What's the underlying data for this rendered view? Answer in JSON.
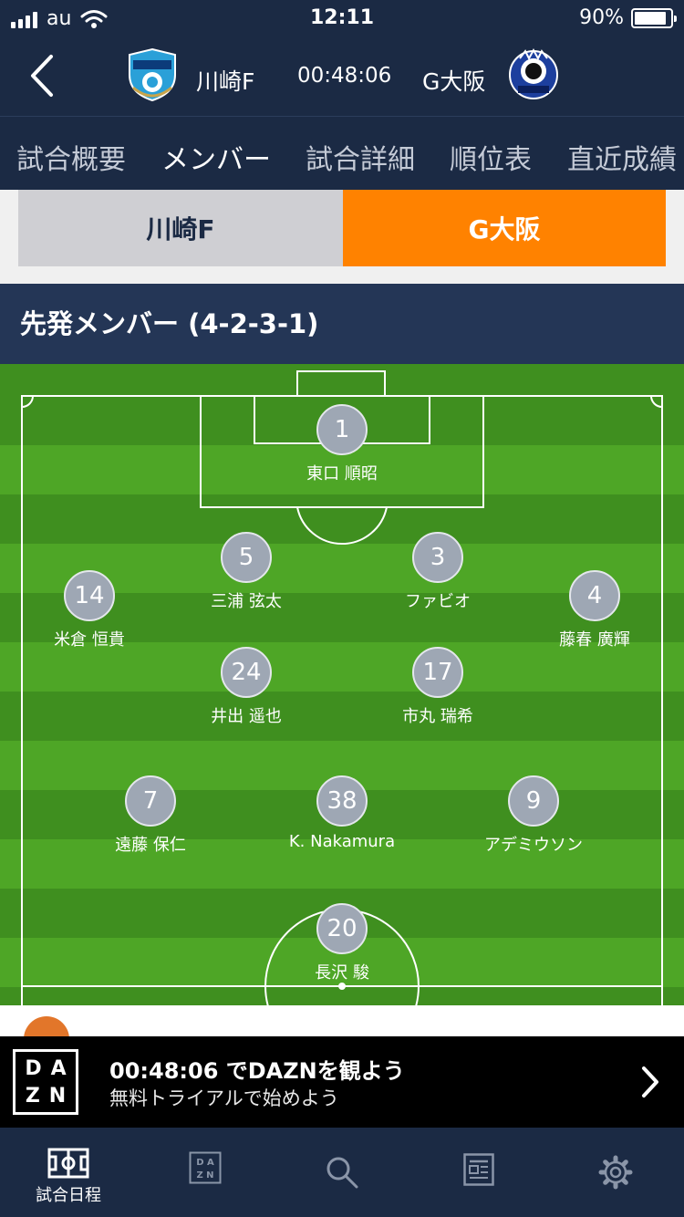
{
  "status_bar": {
    "carrier": "au",
    "time": "12:11",
    "battery_percent": "90%",
    "battery_level": 0.9
  },
  "match": {
    "home_team": "川崎F",
    "away_team": "G大阪",
    "clock": "00:48:06"
  },
  "tabs": [
    {
      "label": "試合概要",
      "active": false
    },
    {
      "label": "メンバー",
      "active": true
    },
    {
      "label": "試合詳細",
      "active": false
    },
    {
      "label": "順位表",
      "active": false
    },
    {
      "label": "直近成績",
      "active": false
    }
  ],
  "team_toggle": {
    "home_label": "川崎F",
    "away_label": "G大阪",
    "selected": "away"
  },
  "lineup": {
    "title": "先発メンバー (4-2-3-1)",
    "players": [
      {
        "number": "1",
        "name": "東口 順昭"
      },
      {
        "number": "5",
        "name": "三浦 弦太"
      },
      {
        "number": "3",
        "name": "ファビオ"
      },
      {
        "number": "14",
        "name": "米倉 恒貴"
      },
      {
        "number": "4",
        "name": "藤春 廣輝"
      },
      {
        "number": "24",
        "name": "井出 遥也"
      },
      {
        "number": "17",
        "name": "市丸 瑞希"
      },
      {
        "number": "7",
        "name": "遠藤 保仁"
      },
      {
        "number": "38",
        "name": "K. Nakamura"
      },
      {
        "number": "9",
        "name": "アデミウソン"
      },
      {
        "number": "20",
        "name": "長沢 駿"
      }
    ]
  },
  "dazn_banner": {
    "logo_text": "DAZN",
    "title": "00:48:06 でDAZNを観よう",
    "subtitle": "無料トライアルで始めよう"
  },
  "bottom_nav": {
    "items": [
      {
        "label": "試合日程",
        "icon": "pitch-icon"
      },
      {
        "label": "",
        "icon": "dazn-icon"
      },
      {
        "label": "",
        "icon": "search-icon"
      },
      {
        "label": "",
        "icon": "news-icon"
      },
      {
        "label": "",
        "icon": "gear-icon"
      }
    ]
  },
  "colors": {
    "header_bg": "#1b2a44",
    "accent_orange": "#ff8200",
    "pitch_dark": "#3f8f1f",
    "pitch_light": "#4ea626",
    "player_circle": "#9ea7b4"
  }
}
